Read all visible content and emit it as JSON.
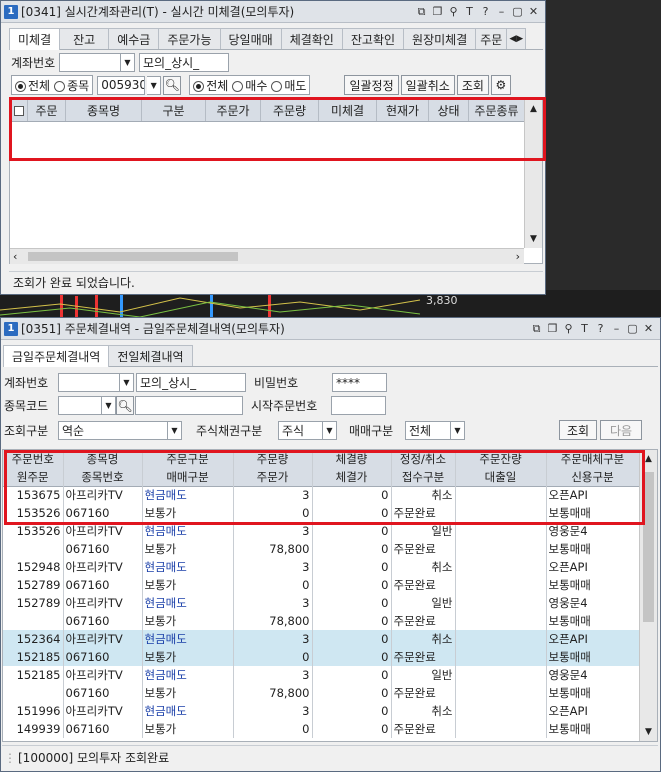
{
  "win1": {
    "title": "[0341] 실시간계좌관리(T) - 실시간 미체결(모의투자)",
    "num": "1",
    "tabs": [
      "미체결",
      "잔고",
      "예수금",
      "주문가능",
      "당일매매",
      "체결확인",
      "잔고확인",
      "원장미체결",
      "주문"
    ],
    "account_label": "계좌번호",
    "account_name": "모의_상시_",
    "radio1": [
      "전체",
      "종목"
    ],
    "stock_code": "005930",
    "radio2": [
      "전체",
      "매수",
      "매도"
    ],
    "btn_modify_all": "일괄정정",
    "btn_cancel_all": "일괄취소",
    "btn_query": "조회",
    "columns": [
      "주문",
      "종목명",
      "구분",
      "주문가",
      "주문량",
      "미체결",
      "현재가",
      "상태",
      "주문종류"
    ],
    "status": "조회가 완료 되었습니다.",
    "side_value": "3,830"
  },
  "win2": {
    "title": "[0351] 주문체결내역 - 금일주문체결내역(모의투자)",
    "num": "1",
    "tabs": [
      "금일주문체결내역",
      "전일체결내역"
    ],
    "account_label": "계좌번호",
    "account_name": "모의_상시_",
    "password_label": "비밀번호",
    "password_value": "****",
    "stock_label": "종목코드",
    "start_order_label": "시작주문번호",
    "query_type_label": "조회구분",
    "query_type_value": "역순",
    "stock_type_label": "주식채권구분",
    "stock_type_value": "주식",
    "trade_type_label": "매매구분",
    "trade_type_value": "전체",
    "btn_query": "조회",
    "btn_next": "다음",
    "header1": [
      "주문번호",
      "종목명",
      "주문구분",
      "주문량",
      "체결량",
      "정정/취소",
      "주문잔량",
      "주문매체구분"
    ],
    "header2": [
      "원주문",
      "종목번호",
      "매매구분",
      "주문가",
      "체결가",
      "접수구분",
      "대출일",
      "신용구분"
    ],
    "rows": [
      {
        "a": [
          "153675",
          "아프리카TV",
          "현금매도",
          "3",
          "0",
          "취소",
          "",
          "오픈API"
        ],
        "b": [
          "153526",
          "067160",
          "보통가",
          "0",
          "0",
          "주문완료",
          "",
          "보통매매"
        ],
        "hl": false
      },
      {
        "a": [
          "153526",
          "아프리카TV",
          "현금매도",
          "3",
          "0",
          "일반",
          "",
          "영웅문4"
        ],
        "b": [
          "",
          "067160",
          "보통가",
          "78,800",
          "0",
          "주문완료",
          "",
          "보통매매"
        ],
        "hl": false
      },
      {
        "a": [
          "152948",
          "아프리카TV",
          "현금매도",
          "3",
          "0",
          "취소",
          "",
          "오픈API"
        ],
        "b": [
          "152789",
          "067160",
          "보통가",
          "0",
          "0",
          "주문완료",
          "",
          "보통매매"
        ],
        "hl": false
      },
      {
        "a": [
          "152789",
          "아프리카TV",
          "현금매도",
          "3",
          "0",
          "일반",
          "",
          "영웅문4"
        ],
        "b": [
          "",
          "067160",
          "보통가",
          "78,800",
          "0",
          "주문완료",
          "",
          "보통매매"
        ],
        "hl": false
      },
      {
        "a": [
          "152364",
          "아프리카TV",
          "현금매도",
          "3",
          "0",
          "취소",
          "",
          "오픈API"
        ],
        "b": [
          "152185",
          "067160",
          "보통가",
          "0",
          "0",
          "주문완료",
          "",
          "보통매매"
        ],
        "hl": true
      },
      {
        "a": [
          "152185",
          "아프리카TV",
          "현금매도",
          "3",
          "0",
          "일반",
          "",
          "영웅문4"
        ],
        "b": [
          "",
          "067160",
          "보통가",
          "78,800",
          "0",
          "주문완료",
          "",
          "보통매매"
        ],
        "hl": false
      },
      {
        "a": [
          "151996",
          "아프리카TV",
          "현금매도",
          "3",
          "0",
          "취소",
          "",
          "오픈API"
        ],
        "b": [
          "149939",
          "067160",
          "보통가",
          "0",
          "0",
          "주문완료",
          "",
          "보통매매"
        ],
        "hl": false
      }
    ],
    "status": "[100000] 모의투자 조회완료"
  }
}
